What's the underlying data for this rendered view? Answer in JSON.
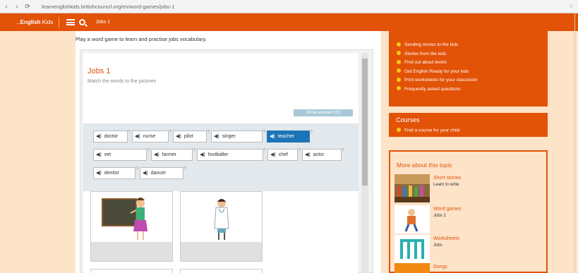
{
  "browser": {
    "back": "‹",
    "forward": "›",
    "reload": "⟳",
    "url": "learnenglishkids.britishcouncil.org/en/word-games/jobs-1",
    "corner": "☆"
  },
  "header": {
    "brand_pre": "...",
    "brand_bold": "English",
    "brand_post": "Kids",
    "link": "Jobs 1"
  },
  "main": {
    "instruction": "Play a word game to learn and practise jobs vocabulary."
  },
  "activity": {
    "title": "Jobs 1",
    "subtitle": "Match the words to the pictures",
    "show_answers": "Show answers (0)",
    "words": [
      {
        "label": "doctor",
        "sup": "?"
      },
      {
        "label": "nurse",
        "sup": "?"
      },
      {
        "label": "pilot",
        "sup": "?"
      },
      {
        "label": "singer",
        "sup": "?"
      },
      {
        "label": "teacher",
        "sup": "?"
      },
      {
        "label": "vet",
        "sup": "?"
      },
      {
        "label": "farmer",
        "sup": "?"
      },
      {
        "label": "footballer",
        "sup": "?"
      },
      {
        "label": "chef",
        "sup": "?"
      },
      {
        "label": "actor",
        "sup": "?"
      },
      {
        "label": "dentist",
        "sup": "?"
      },
      {
        "label": "dancer",
        "sup": "?"
      }
    ]
  },
  "sidebar": {
    "help_items": [
      "Sending stories to the kids",
      "Stories from the kids",
      "Find out about levels",
      "Get English Ready for your kids",
      "Print worksheets for your classroom",
      "Frequently asked questions"
    ],
    "courses_heading": "Courses",
    "courses_item": "Find a course for your child",
    "more_heading": "More about this topic",
    "topics": [
      {
        "title": "Short stories",
        "sub": "Learn to write"
      },
      {
        "title": "Word games",
        "sub": "Jobs 2"
      },
      {
        "title": "Worksheets",
        "sub": "Jobs"
      },
      {
        "title": "Songs",
        "sub": ""
      }
    ]
  },
  "colors": {
    "accent": "#e25207",
    "selected": "#1d75b8",
    "bullet": "#f7c520"
  }
}
